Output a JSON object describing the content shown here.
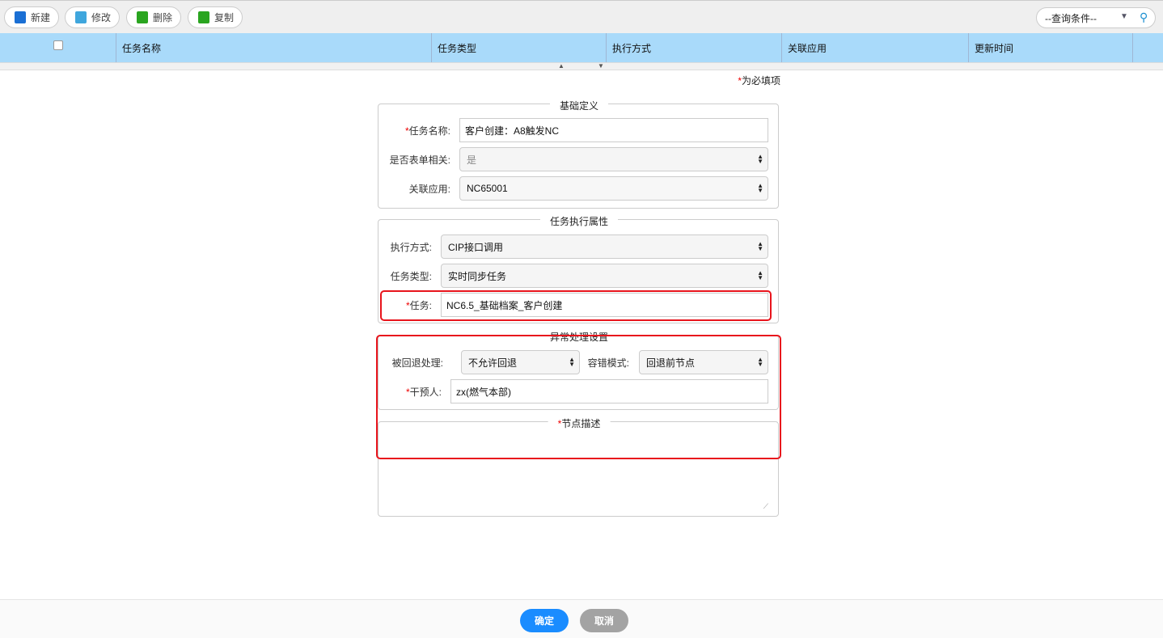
{
  "toolbar": {
    "buttons": [
      {
        "label": "新建",
        "icon": "new-file-icon",
        "color": "#1a6fd4"
      },
      {
        "label": "修改",
        "icon": "edit-icon",
        "color": "#3fa6dd"
      },
      {
        "label": "删除",
        "icon": "trash-icon",
        "color": "#2aa520"
      },
      {
        "label": "复制",
        "icon": "copy-icon",
        "color": "#2aa520"
      }
    ],
    "search": {
      "value": "--查询条件--"
    }
  },
  "grid": {
    "columns": [
      "任务名称",
      "任务类型",
      "执行方式",
      "关联应用",
      "更新时间"
    ]
  },
  "form": {
    "required_note": "为必填项",
    "required_mark": "*",
    "basic": {
      "legend": "基础定义",
      "task_name_label": "任务名称:",
      "task_name_value": "客户创建：A8触发NC",
      "form_related_label": "是否表单相关:",
      "form_related_value": "是",
      "app_label": "关联应用:",
      "app_value": "NC65001"
    },
    "exec": {
      "legend": "任务执行属性",
      "mode_label": "执行方式:",
      "mode_value": "CIP接口调用",
      "type_label": "任务类型:",
      "type_value": "实时同步任务",
      "task_label": "任务:",
      "task_value": "NC6.5_基础档案_客户创建"
    },
    "exception": {
      "legend": "异常处理设置",
      "rollback_label": "被回退处理:",
      "rollback_value": "不允许回退",
      "fault_label": "容错模式:",
      "fault_value": "回退前节点",
      "intervener_label": "干预人:",
      "intervener_value": "zx(燃气本部)"
    },
    "desc": {
      "legend": "节点描述",
      "value": ""
    }
  },
  "footer": {
    "ok": "确定",
    "cancel": "取消",
    "ok_color": "#1a8cff",
    "cancel_color": "#a3a3a3"
  }
}
